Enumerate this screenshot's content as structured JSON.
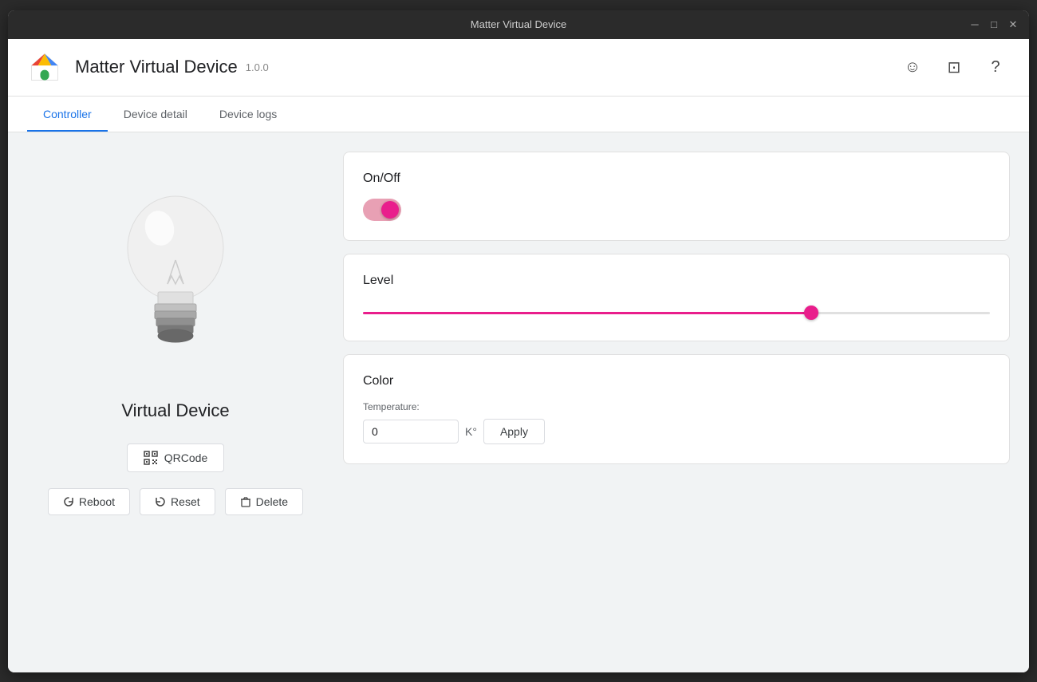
{
  "titlebar": {
    "title": "Matter Virtual Device",
    "minimize_label": "─",
    "maximize_label": "□",
    "close_label": "✕"
  },
  "header": {
    "app_title": "Matter Virtual Device",
    "app_version": "1.0.0",
    "emoji_icon_title": "emoji",
    "feedback_icon_title": "feedback",
    "help_icon_title": "help"
  },
  "tabs": [
    {
      "id": "controller",
      "label": "Controller",
      "active": true
    },
    {
      "id": "device-detail",
      "label": "Device detail",
      "active": false
    },
    {
      "id": "device-logs",
      "label": "Device logs",
      "active": false
    }
  ],
  "left_panel": {
    "device_name": "Virtual Device",
    "qrcode_button_label": "QRCode",
    "reboot_button_label": "Reboot",
    "reset_button_label": "Reset",
    "delete_button_label": "Delete"
  },
  "cards": {
    "onoff": {
      "title": "On/Off",
      "toggle_state": true
    },
    "level": {
      "title": "Level",
      "slider_value": 72,
      "slider_min": 0,
      "slider_max": 100
    },
    "color": {
      "title": "Color",
      "temperature_label": "Temperature:",
      "temperature_value": "0",
      "temperature_unit": "K°",
      "apply_label": "Apply"
    }
  }
}
